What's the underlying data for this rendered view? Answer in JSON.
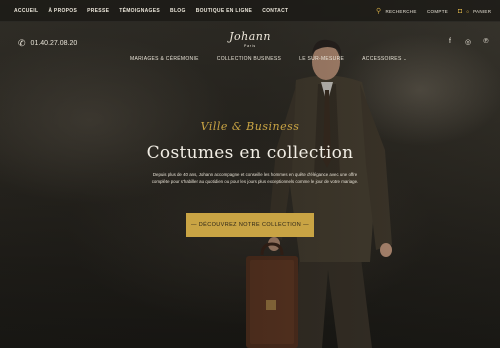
{
  "topbar": {
    "nav": [
      "ACCUEIL",
      "À PROPOS",
      "PRESSE",
      "TÉMOIGNAGES",
      "BLOG",
      "BOUTIQUE EN LIGNE",
      "CONTACT"
    ],
    "search_label": "RECHERCHE",
    "account_label": "COMPTE",
    "cart_label": "PANIER",
    "cart_count": "0"
  },
  "header": {
    "phone": "01.40.27.08.20",
    "logo_name": "Johann",
    "logo_city": "Paris",
    "nav": [
      "MARIAGES & CÉRÉMONIE",
      "COLLECTION BUSINESS",
      "LE SUR-MESURE",
      "ACCESSOIRES"
    ]
  },
  "hero": {
    "script": "Ville & Business",
    "title": "Costumes en collection",
    "description": "Depuis plus de 40 ans, Johann accompagne et conseille les hommes en quête d'élégance avec une offre complète pour s'habiller au quotidien ou pour les jours plus exceptionnels comme le jour de votre mariage.",
    "cta": "— DÉCOUVREZ NOTRE COLLECTION —"
  },
  "colors": {
    "accent": "#c9a444",
    "bar": "#1a1814"
  }
}
